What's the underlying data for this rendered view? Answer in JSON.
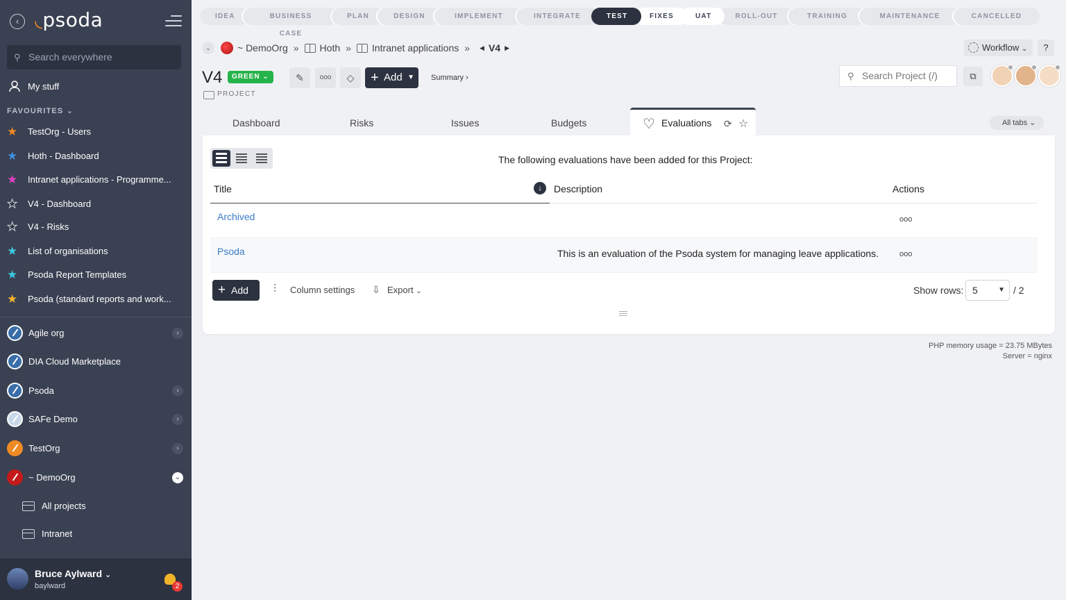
{
  "sidebar": {
    "logo": "psoda",
    "search_placeholder": "Search everywhere",
    "my_stuff": "My stuff",
    "favourites_heading": "FAVOURITES",
    "favourites": [
      {
        "label": "TestOrg - Users",
        "color": "#f08a24"
      },
      {
        "label": "Hoth - Dashboard",
        "color": "#3f8fe0"
      },
      {
        "label": "Intranet applications - Programme...",
        "color": "#e040c0"
      },
      {
        "label": "V4 - Dashboard",
        "color": "#2a2f3a"
      },
      {
        "label": "V4 - Risks",
        "color": "#2a2f3a"
      },
      {
        "label": "List of organisations",
        "color": "#3ec6e0"
      },
      {
        "label": "Psoda Report Templates",
        "color": "#3ec6e0"
      },
      {
        "label": "Psoda (standard reports and work...",
        "color": "#f0b429"
      }
    ],
    "orgs": [
      {
        "label": "Agile org",
        "has_chevron": true
      },
      {
        "label": "DIA Cloud Marketplace",
        "has_chevron": false
      },
      {
        "label": "Psoda",
        "has_chevron": true
      },
      {
        "label": "SAFe Demo",
        "has_chevron": true
      },
      {
        "label": "TestOrg",
        "has_chevron": true
      },
      {
        "label": "~ DemoOrg",
        "has_chevron": true,
        "open": true
      }
    ],
    "sub_items": [
      "All projects",
      "Intranet"
    ],
    "user": {
      "name": "Bruce Aylward",
      "handle": "baylward",
      "notifications": "2"
    }
  },
  "phases": [
    {
      "label": "IDEA",
      "state": "todo"
    },
    {
      "label": "BUSINESS CASE",
      "state": "todo"
    },
    {
      "label": "PLAN",
      "state": "todo"
    },
    {
      "label": "DESIGN",
      "state": "todo"
    },
    {
      "label": "IMPLEMENT",
      "state": "todo"
    },
    {
      "label": "INTEGRATE",
      "state": "todo"
    },
    {
      "label": "TEST",
      "state": "active"
    },
    {
      "label": "FIXES",
      "state": "done"
    },
    {
      "label": "UAT",
      "state": "done"
    },
    {
      "label": "ROLL-OUT",
      "state": "todo"
    },
    {
      "label": "TRAINING",
      "state": "todo"
    },
    {
      "label": "MAINTENANCE",
      "state": "todo"
    },
    {
      "label": "CANCELLED",
      "state": "todo"
    }
  ],
  "breadcrumb": {
    "org": "~ DemoOrg",
    "sep": "»",
    "items": [
      "Hoth",
      "Intranet applications"
    ],
    "current": "V4"
  },
  "header": {
    "workflow": "Workflow",
    "help": "?",
    "title": "V4",
    "status": "GREEN",
    "type": "PROJECT",
    "more": "ooo",
    "add": "Add",
    "summary": "Summary ›",
    "search_placeholder": "Search Project (/)"
  },
  "tabs": {
    "items": [
      "Dashboard",
      "Risks",
      "Issues",
      "Budgets"
    ],
    "active": "Evaluations",
    "all_tabs": "All tabs"
  },
  "panel": {
    "intro": "The following evaluations have been added for this Project:",
    "columns": {
      "title": "Title",
      "description": "Description",
      "actions": "Actions"
    },
    "rows": [
      {
        "title": "Archived",
        "description": "",
        "actions": "ooo"
      },
      {
        "title": "Psoda",
        "description": "This is an evaluation of the Psoda system for managing leave applications.",
        "actions": "ooo"
      }
    ],
    "footer": {
      "add": "Add",
      "column_settings": "Column settings",
      "export": "Export",
      "show_rows_label": "Show rows:",
      "show_rows_value": "5",
      "pages": "/ 2"
    }
  },
  "server": {
    "memory": "PHP memory usage = 23.75 MBytes",
    "server": "Server = nginx"
  }
}
